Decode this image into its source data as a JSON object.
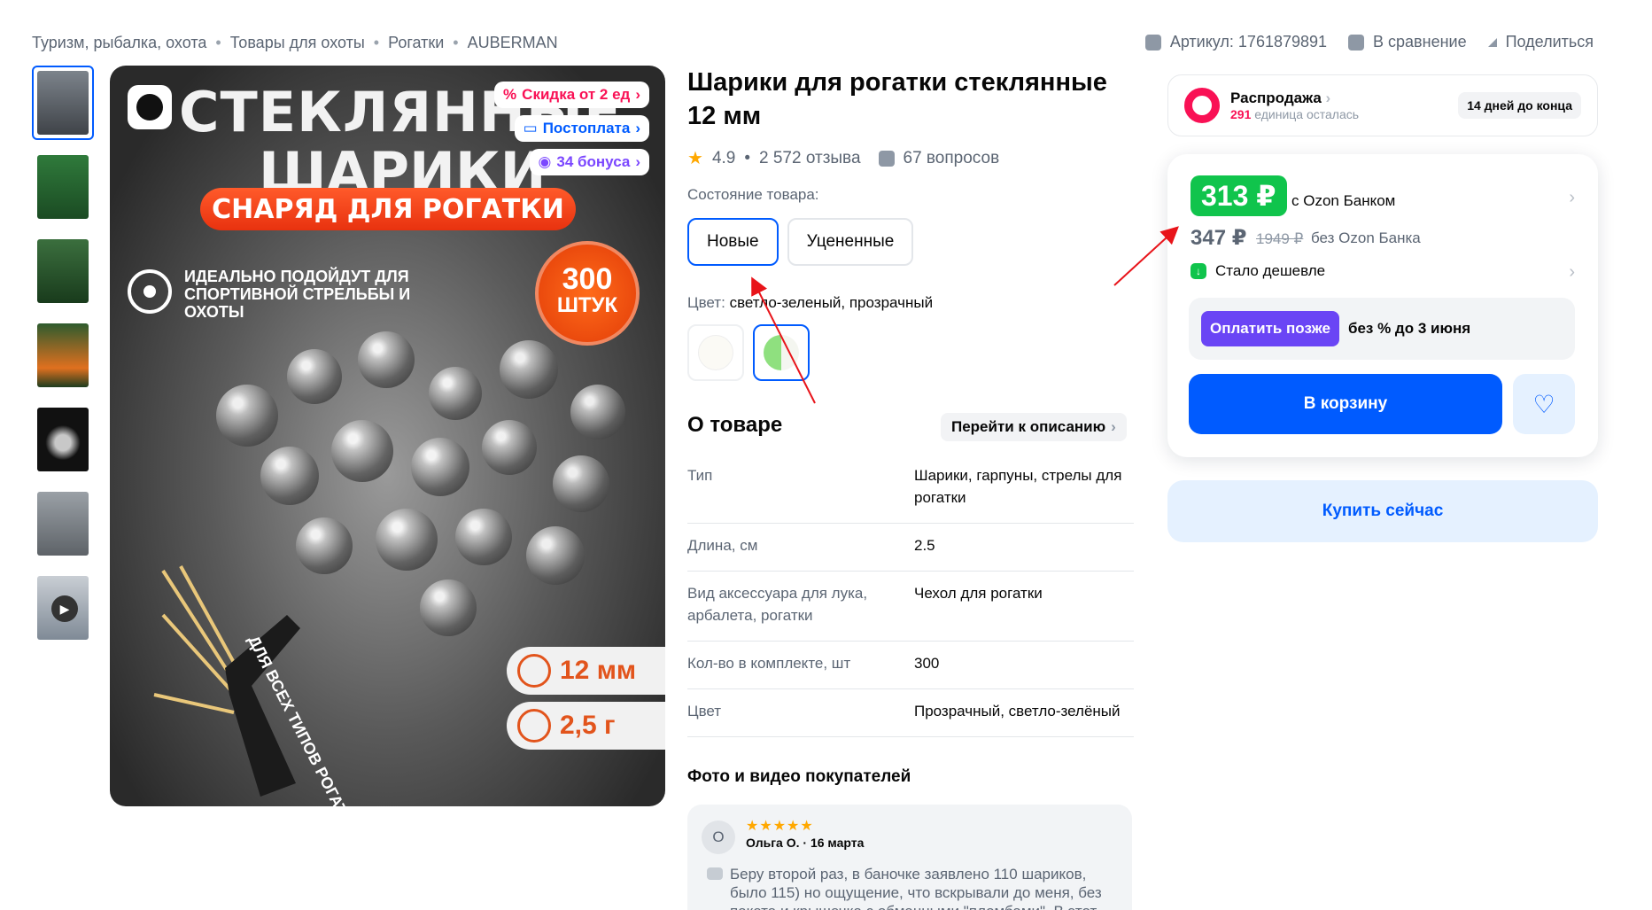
{
  "breadcrumb": [
    "Туризм, рыбалка, охота",
    "Товары для охоты",
    "Рогатки",
    "AUBERMAN"
  ],
  "breadcrumb_separator": "•",
  "top_actions": {
    "article": "Артикул: 1761879891",
    "compare": "В сравнение",
    "share": "Поделиться"
  },
  "gallery": {
    "thumbnail_count": 7,
    "main_image": {
      "title_line1": "СТЕКЛЯННЫЕ",
      "title_line2": "ШАРИКИ",
      "banner": "СНАРЯД ДЛЯ РОГАТКИ",
      "subtitle_bold": "ИДЕАЛЬНО",
      "subtitle_rest": "ПОДОЙДУТ ДЛЯ СПОРТИВНОЙ СТРЕЛЬБЫ И ОХОТЫ",
      "count_big": "300",
      "count_small": "ШТУК",
      "size_pill": "12 мм",
      "weight_pill": "2,5 г",
      "side_text": "ДЛЯ ВСЕХ ТИПОВ РОГАТОК"
    },
    "badges": {
      "discount": "Скидка от 2 ед",
      "postpay": "Постоплата",
      "bonus": "34 бонуса"
    }
  },
  "product": {
    "title": "Шарики для рогатки стеклянные 12 мм",
    "rating": "4.9",
    "reviews": "2 572 отзыва",
    "questions": "67 вопросов",
    "condition_label": "Состояние товара:",
    "conditions": [
      "Новые",
      "Уцененные"
    ],
    "color_label": "Цвет:",
    "color_value": "светло-зеленый, прозрачный"
  },
  "about": {
    "heading": "О товаре",
    "link": "Перейти к описанию",
    "specs": [
      {
        "k": "Тип",
        "v": "Шарики, гарпуны, стрелы для рогатки"
      },
      {
        "k": "Длина, см",
        "v": "2.5"
      },
      {
        "k": "Вид аксессуара для лука, арбалета, рогатки",
        "v": "Чехол для рогатки"
      },
      {
        "k": "Кол-во в комплекте, шт",
        "v": "300"
      },
      {
        "k": "Цвет",
        "v": "Прозрачный, светло-зелёный"
      }
    ]
  },
  "photos": {
    "heading": "Фото и видео покупателей",
    "review": {
      "avatar": "О",
      "author": "Ольга О.",
      "date": "16 марта",
      "stars": "★★★★★",
      "text": "Беру второй раз, в баночке заявлено 110 шариков, было 115) но ощущение, что вскрывали до меня, без пакета и крышечка с обманными \"пломбами\". В этот"
    }
  },
  "sale": {
    "title": "Распродажа",
    "remaining_count": "291",
    "remaining_text": "единица осталась",
    "days": "14 дней до конца"
  },
  "price": {
    "main": "313 ₽",
    "bank_note": "с Ozon Банком",
    "old": "347 ₽",
    "crossed": "1949 ₽",
    "no_bank": "без Ozon Банка",
    "cheaper": "Стало дешевле",
    "pay_later_btn": "Оплатить позже",
    "pay_later_text": "без % до 3 июня",
    "cart": "В корзину",
    "buy_now": "Купить сейчас"
  },
  "colors": {
    "accent": "#005bff",
    "price_green": "#10c44c",
    "sale_pink": "#f91155",
    "pay_later_violet": "#6a45f5",
    "annotation_red": "#e8141a"
  }
}
